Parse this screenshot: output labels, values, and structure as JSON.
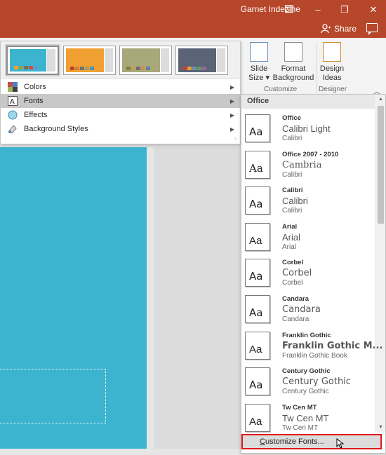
{
  "titlebar": {
    "user": "Garnet Indezine",
    "restore_icon": "ribbon-display-icon",
    "minimize_label": "–",
    "maximize_label": "❐",
    "close_label": "✕",
    "share_label": "Share"
  },
  "ribbon": {
    "slide_size_label": "Slide Size ▾",
    "format_background_label": "Format Background",
    "customize_group": "Customize",
    "design_ideas_label": "Design Ideas",
    "designer_group": "Designer"
  },
  "gallery": {
    "variants": [
      {
        "bg": "#3cb4cf",
        "swatches": [
          "#f0a030",
          "#8fa04a",
          "#6e6e6e",
          "#d04e3a",
          "#5a9ad0"
        ]
      },
      {
        "bg": "#f0a030",
        "swatches": [
          "#c04030",
          "#d08040",
          "#707070",
          "#a0a060",
          "#5090c0"
        ]
      },
      {
        "bg": "#a8a87a",
        "swatches": [
          "#808040",
          "#c0a060",
          "#707070",
          "#d09050",
          "#6080a0"
        ]
      },
      {
        "bg": "#5a6476",
        "swatches": [
          "#c04040",
          "#e0a030",
          "#7090b0",
          "#60a060",
          "#a060a0"
        ]
      }
    ],
    "menu": [
      {
        "label": "Colors",
        "icon": "colors-icon"
      },
      {
        "label": "Fonts",
        "icon": "fonts-icon"
      },
      {
        "label": "Effects",
        "icon": "effects-icon"
      },
      {
        "label": "Background Styles",
        "icon": "background-styles-icon"
      }
    ]
  },
  "fonts_panel": {
    "header": "Office",
    "items": [
      {
        "name": "Office",
        "heading": "Calibri Light",
        "body": "Calibri"
      },
      {
        "name": "Office 2007 - 2010",
        "heading": "Cambria",
        "body": "Calibri"
      },
      {
        "name": "Calibri",
        "heading": "Calibri",
        "body": "Calibri"
      },
      {
        "name": "Arial",
        "heading": "Arial",
        "body": "Arial"
      },
      {
        "name": "Corbel",
        "heading": "Corbel",
        "body": "Corbel"
      },
      {
        "name": "Candara",
        "heading": "Candara",
        "body": "Candara"
      },
      {
        "name": "Franklin Gothic",
        "heading": "Franklin Gothic M...",
        "body": "Franklin Gothic Book"
      },
      {
        "name": "Century Gothic",
        "heading": "Century Gothic",
        "body": "Century Gothic"
      },
      {
        "name": "Tw Cen MT",
        "heading": "Tw Cen MT",
        "body": "Tw Cen MT"
      }
    ],
    "aa_glyph": "Aa",
    "customize_label_pre": "",
    "customize_label_ul": "C",
    "customize_label_post": "ustomize Fonts..."
  },
  "colors": {
    "titlebar": "#b7472a",
    "slide": "#3cb4cf",
    "highlight_border": "#e01a1a"
  }
}
